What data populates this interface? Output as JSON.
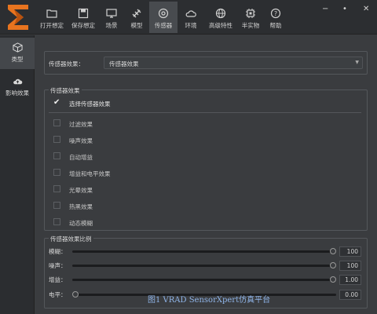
{
  "toolbar": {
    "items": [
      {
        "label": "打开想定",
        "icon": "folder-icon"
      },
      {
        "label": "保存想定",
        "icon": "save-icon"
      },
      {
        "label": "场景",
        "icon": "monitor-icon"
      },
      {
        "label": "模型",
        "icon": "satellite-icon"
      },
      {
        "label": "传感器",
        "icon": "camera-icon",
        "active": true
      },
      {
        "label": "环境",
        "icon": "cloud-icon"
      },
      {
        "label": "高级特性",
        "icon": "globe-icon"
      },
      {
        "label": "半实物",
        "icon": "chip-icon"
      },
      {
        "label": "帮助",
        "icon": "help-icon"
      }
    ],
    "window_controls": [
      "−",
      "•",
      "✕"
    ]
  },
  "sidebar": {
    "items": [
      {
        "label": "类型",
        "icon": "cube-icon",
        "active": true
      },
      {
        "label": "影响效果",
        "icon": "cloud-upload-icon"
      }
    ]
  },
  "sensor_effect_select": {
    "label": "传感器效果：",
    "value": "传感器效果"
  },
  "effects_group": {
    "title": "传感器效果",
    "select_all": {
      "label": "选择传感器效果",
      "checked": true
    },
    "options": [
      {
        "label": "过滤效果",
        "checked": false
      },
      {
        "label": "噪声效果",
        "checked": false
      },
      {
        "label": "自动增益",
        "checked": false
      },
      {
        "label": "增益和电平效果",
        "checked": false
      },
      {
        "label": "光晕效果",
        "checked": false
      },
      {
        "label": "热黑效果",
        "checked": false
      },
      {
        "label": "动态模糊",
        "checked": false
      }
    ]
  },
  "ratio_group": {
    "title": "传感器效果比例",
    "sliders": [
      {
        "label": "模糊：",
        "value": "100",
        "level": 1.0
      },
      {
        "label": "噪声：",
        "value": "100",
        "level": 1.0
      },
      {
        "label": "增益：",
        "value": "1.00",
        "level": 1.0
      },
      {
        "label": "电平：",
        "value": "0.00",
        "level": 0.0
      }
    ]
  },
  "caption": "图1 VRAD SensorXpert仿真平台",
  "colors": {
    "background": "#3a3c3f",
    "toolbar": "#2c2e31",
    "accent_logo": "#e8741f",
    "active_tab": "#484b4f"
  }
}
